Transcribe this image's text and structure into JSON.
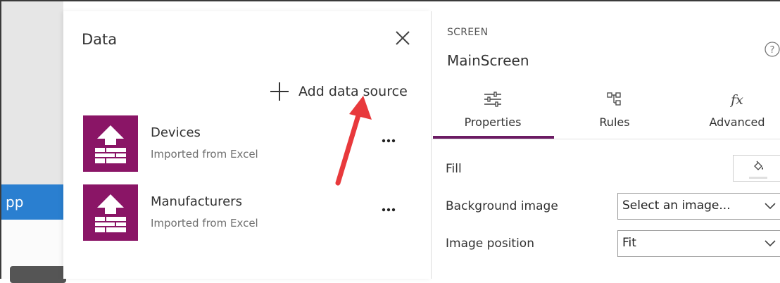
{
  "backdrop": {
    "app_bar_text": "pp"
  },
  "data_panel": {
    "title": "Data",
    "add_source_label": "Add data source",
    "sources": [
      {
        "name": "Devices",
        "subtitle": "Imported from Excel",
        "icon": "excel-import-icon"
      },
      {
        "name": "Manufacturers",
        "subtitle": "Imported from Excel",
        "icon": "excel-import-icon"
      }
    ]
  },
  "props_panel": {
    "section_label": "SCREEN",
    "screen_name": "MainScreen",
    "tabs": [
      {
        "label": "Properties",
        "icon": "sliders-icon",
        "selected": true
      },
      {
        "label": "Rules",
        "icon": "flow-icon",
        "selected": false
      },
      {
        "label": "Advanced",
        "icon": "fx-icon",
        "selected": false
      }
    ],
    "fill_label": "Fill",
    "background_image_label": "Background image",
    "background_image_value": "Select an image...",
    "image_position_label": "Image position",
    "image_position_value": "Fit"
  },
  "colors": {
    "accent": "#6b1b63",
    "data_icon": "#8a1566",
    "app_bar": "#2a7fd0",
    "annotation_arrow": "#e8393c"
  }
}
